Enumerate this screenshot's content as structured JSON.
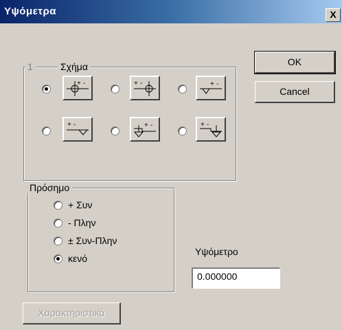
{
  "window": {
    "title": "Υψόμετρα",
    "close_glyph": "X"
  },
  "shape_group": {
    "number": "1",
    "label": "Σχήμα",
    "selected_index": 0
  },
  "buttons": {
    "ok": "OK",
    "cancel": "Cancel",
    "characteristics": "Χαρακτηριστικά"
  },
  "sign_group": {
    "label": "Πρόσημο",
    "options": [
      "+ Συν",
      "- Πλην",
      "± Συν-Πλην",
      "κενό"
    ],
    "selected_index": 3
  },
  "elevation": {
    "label": "Υψόμετρο",
    "value": "0.000000"
  },
  "shape_button_marks": {
    "plus": "+",
    "minus": "-"
  }
}
